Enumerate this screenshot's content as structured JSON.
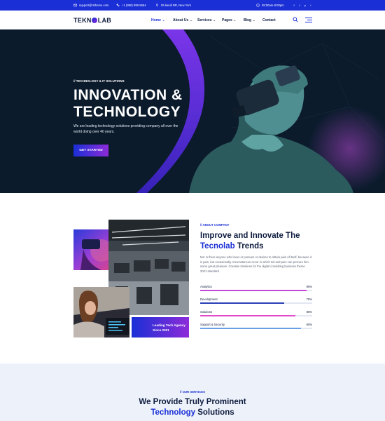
{
  "topbar": {
    "email": "support@rstheme.com",
    "phone": "+1 (990) 999-5554",
    "address": "05 kandi BR, New York",
    "hours": "08:00am-6:00pm",
    "social": [
      "f",
      "t",
      "p",
      "i"
    ]
  },
  "nav": {
    "logo_pre": "TEKN",
    "logo_post": "LAB",
    "items": [
      {
        "label": "Home",
        "active": true
      },
      {
        "label": "About Us",
        "active": false
      },
      {
        "label": "Services",
        "active": false
      },
      {
        "label": "Pages",
        "active": false
      },
      {
        "label": "Blog",
        "active": false
      },
      {
        "label": "Contact",
        "active": false
      }
    ]
  },
  "hero": {
    "kicker": "// TECHNOLOGY & IT SOLUTIONS",
    "title_line1": "INNOVATION &",
    "title_line2": "TECHNOLOGY",
    "subtitle": "We are leading technology solutions providing company all over the world doing over 40 years.",
    "cta": "GET STARTED"
  },
  "about": {
    "kicker": "// ABOUT COMPANY",
    "title_line1": "Improve and Innovate The",
    "title_hl": "Tecnolab",
    "title_rest": " Trends",
    "text": "Nor is there anyone who loves or pursues or desires to obtain pain of itself, because it is pain, but occasionally circumstances occur in which toil and pain can procure him some great pleasure. Creation timelines for the digital consulting business theme 2021 standard",
    "badge_line1": "Leading Tech Agency",
    "badge_line2": "Since 2001",
    "skills": [
      {
        "name": "Analytics",
        "pct_label": "95%",
        "value": 95,
        "color": "#c24ad9"
      },
      {
        "name": "Development",
        "pct_label": "75%",
        "value": 75,
        "color": "#2a3fb8"
      },
      {
        "name": "Solutions",
        "pct_label": "85%",
        "value": 85,
        "color": "#e24ac9"
      },
      {
        "name": "Support & Security",
        "pct_label": "90%",
        "value": 90,
        "color": "#6aa0e8"
      }
    ]
  },
  "services": {
    "kicker": "// OUR SERVICES",
    "title_line1": "We Provide Truly Prominent",
    "title_hl": "Technology",
    "title_rest": " Solutions"
  },
  "colors": {
    "primary": "#1a2fd6",
    "accent": "#8d2bd9",
    "dark": "#0d1b3e"
  }
}
